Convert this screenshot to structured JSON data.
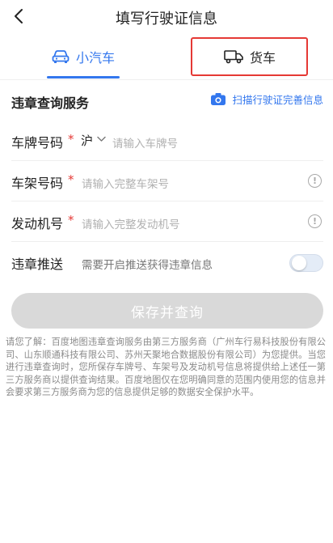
{
  "header": {
    "title": "填写行驶证信息",
    "back_icon": "chevron-left-icon"
  },
  "tabs": {
    "car_label": "小汽车",
    "truck_label": "货车",
    "active": "car",
    "accent_color": "#3377ee",
    "highlight_color": "#e53935"
  },
  "section": {
    "title": "违章查询服务",
    "scan_label": "扫描行驶证完善信息"
  },
  "form": {
    "plate": {
      "label": "车牌号码",
      "required_mark": "*",
      "province": "沪",
      "placeholder": "请输入车牌号"
    },
    "frame": {
      "label": "车架号码",
      "required_mark": "*",
      "placeholder": "请输入完整车架号"
    },
    "engine": {
      "label": "发动机号",
      "required_mark": "*",
      "placeholder": "请输入完整发动机号"
    },
    "push": {
      "label": "违章推送",
      "description": "需要开启推送获得违章信息",
      "enabled": false
    }
  },
  "save_button": {
    "label": "保存并查询",
    "disabled": true
  },
  "disclaimer": "请您了解：百度地图违章查询服务由第三方服务商（广州车行易科技股份有限公司、山东顺通科技有限公司、苏州天聚地合数据股份有限公司）为您提供。当您进行违章查询时，您所保存车牌号、车架号及发动机号信息将提供给上述任一第三方服务商以提供查询结果。百度地图仅在您明确同意的范围内使用您的信息并会要求第三方服务商为您的信息提供足够的数据安全保护水平。"
}
